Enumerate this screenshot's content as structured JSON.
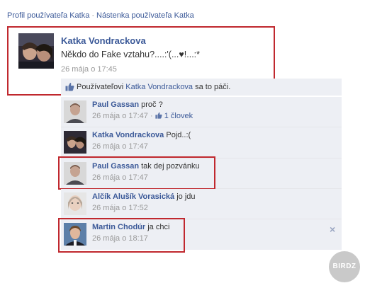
{
  "breadcrumb": {
    "profile": "Profil používateľa Katka",
    "separator": "·",
    "wall": "Nástenka používateľa Katka"
  },
  "post": {
    "author": "Katka Vondrackova",
    "text": "Někdo do Fake vztahu?....:'(...♥!...:*",
    "time": "26 mája o 17:45"
  },
  "likes": {
    "prefix": "Používateľovi",
    "name": "Katka Vondrackova",
    "suffix": "sa to páči."
  },
  "comments": [
    {
      "author": "Paul Gassan",
      "text": "proč ?",
      "time": "26 mája o 17:47",
      "sep": "·",
      "likes": "1 človek"
    },
    {
      "author": "Katka Vondrackova",
      "text": "Pojd..:(",
      "time": "26 mája o 17:47"
    },
    {
      "author": "Paul Gassan",
      "text": "tak dej pozvánku",
      "time": "26 mája o 17:47"
    },
    {
      "author": "Alčík Alušík Vorasická",
      "text": "jo jdu",
      "time": "26 mája o 17:52"
    },
    {
      "author": "Martin Chodúr",
      "text": "ja chci",
      "time": "26 mája o 18:17"
    }
  ],
  "close_icon": "×",
  "watermark": "BIRDZ",
  "colors": {
    "link": "#3b5998",
    "comment_bg": "#edeff4",
    "highlight_border": "#c0282e",
    "timestamp": "#999999"
  }
}
